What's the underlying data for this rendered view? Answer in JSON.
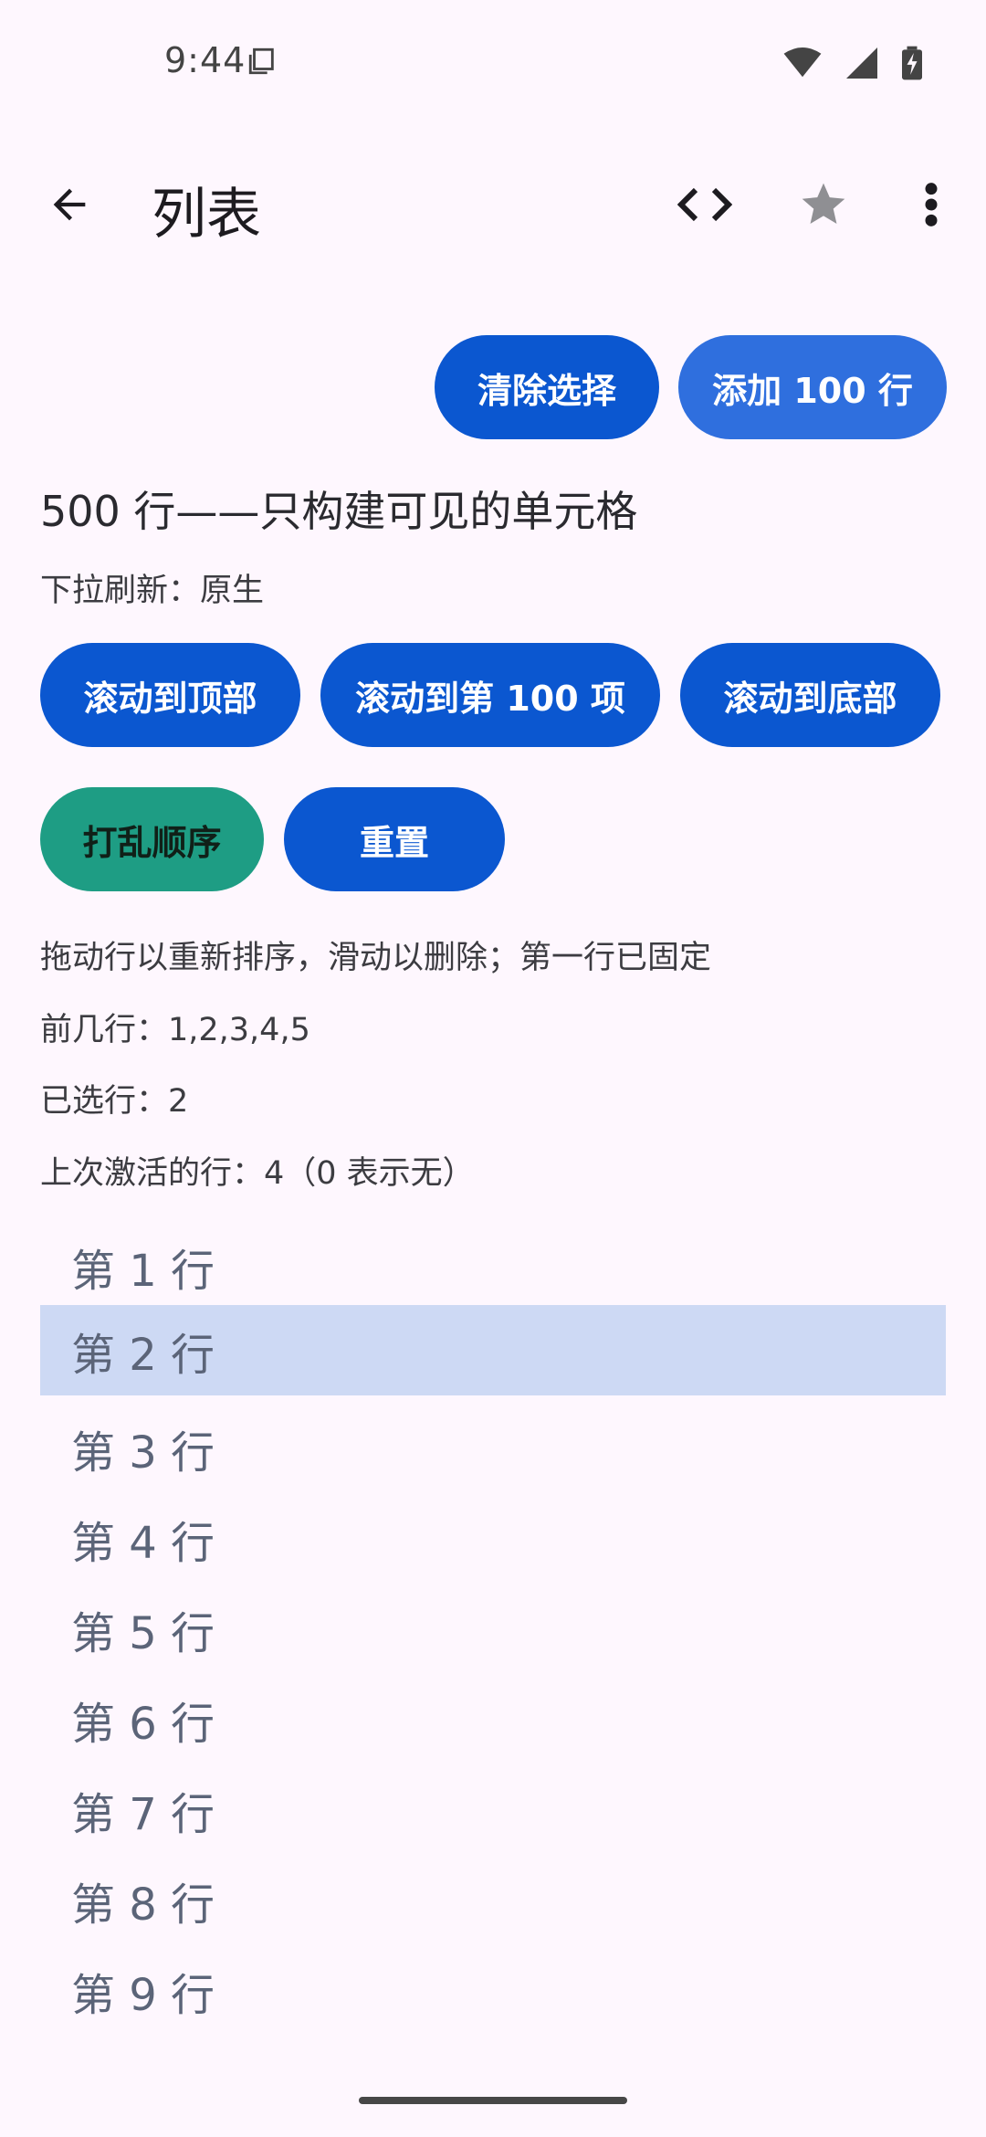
{
  "status_bar": {
    "time": "9:44"
  },
  "app_bar": {
    "title": "列表"
  },
  "actions": {
    "clear_selection": "清除选择",
    "add_rows": "添加 100 行"
  },
  "main": {
    "heading": "500 行——只构建可见的单元格",
    "pull_refresh": "下拉刷新：原生",
    "scroll_top": "滚动到顶部",
    "scroll_100": "滚动到第 100 项",
    "scroll_bottom": "滚动到底部",
    "shuffle": "打乱顺序",
    "reset": "重置",
    "hint": "拖动行以重新排序，滑动以删除；第一行已固定",
    "first_rows": "前几行：1,2,3,4,5",
    "selected": "已选行：2",
    "last_activated": "上次激活的行：4（0 表示无）"
  },
  "rows": [
    {
      "label": "第 1 行",
      "selected": false
    },
    {
      "label": "第 2 行",
      "selected": true
    },
    {
      "label": "第 3 行",
      "selected": false
    },
    {
      "label": "第 4 行",
      "selected": false
    },
    {
      "label": "第 5 行",
      "selected": false
    },
    {
      "label": "第 6 行",
      "selected": false
    },
    {
      "label": "第 7 行",
      "selected": false
    },
    {
      "label": "第 8 行",
      "selected": false
    },
    {
      "label": "第 9 行",
      "selected": false
    }
  ],
  "icons": {
    "back": "back-arrow-icon",
    "code": "code-icon",
    "star": "star-icon",
    "more": "more-vert-icon"
  },
  "colors": {
    "background": "#FEF7FE",
    "primary": "#0B57D0",
    "primary_light": "#2F6FDE",
    "green": "#1E9D84",
    "selected_row": "#CDD9F4"
  }
}
